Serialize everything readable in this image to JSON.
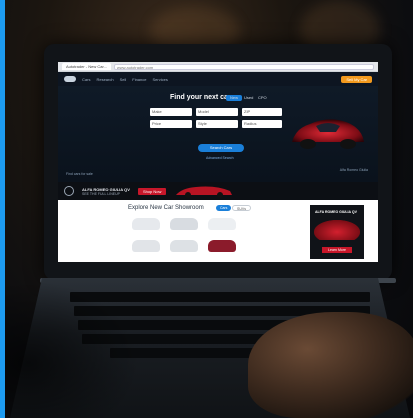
{
  "browser": {
    "tab_label": "Autotrader - New Car...",
    "url": "www.autotrader.com"
  },
  "site": {
    "nav": [
      "Cars",
      "Research",
      "Sell",
      "Finance",
      "Services"
    ],
    "sell_button": "Sell My Car",
    "hero_title": "Find your next car",
    "toggle_new": "New",
    "toggle_used": "Used",
    "toggle_cpo": "CPO",
    "fields": [
      "Make",
      "Model",
      "ZIP",
      "Price",
      "Style",
      "Radius"
    ],
    "search_button": "Search Cars",
    "advanced_link": "Advanced Search",
    "hero_caption_left": "Find cars for sale",
    "hero_caption_right": "Alfa Romeo Giulia"
  },
  "ad_strip": {
    "text": "ALFA ROMEO GIULIA QV",
    "subtext": "SEE THE FULL LINEUP",
    "button": "Shop Now"
  },
  "explore": {
    "title": "Explore New Car Showroom",
    "pill_a": "Cars",
    "pill_b": "SUVs"
  },
  "ad_box": {
    "title": "ALFA ROMEO GIULIA QV",
    "button": "Learn More"
  },
  "colors": {
    "accent_blue": "#1d9bf0",
    "sell_orange": "#f39a1e",
    "brand_red": "#c8172a"
  }
}
